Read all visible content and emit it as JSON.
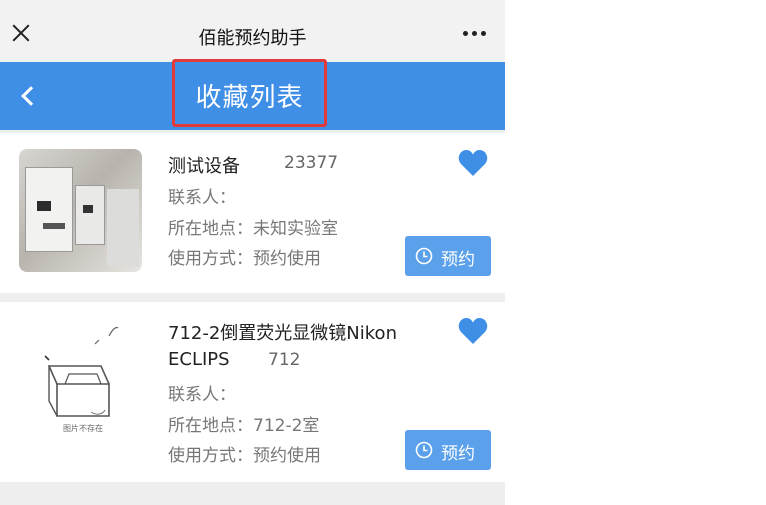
{
  "wx_bar": {
    "title": "佰能预约助手"
  },
  "header": {
    "title": "收藏列表"
  },
  "items": [
    {
      "name": "测试设备",
      "code": "23377",
      "contact": "联系人：",
      "location": "所在地点：未知实验室",
      "usage": "使用方式：预约使用",
      "reserve_label": "预约"
    },
    {
      "name_line1": "712-2倒置荧光显微镜Nikon",
      "name_line2": "ECLIPS",
      "code": "712",
      "contact": "联系人：",
      "location": "所在地点：712-2室",
      "usage": "使用方式：预约使用",
      "reserve_label": "预约",
      "image_caption": "图片不存在"
    }
  ],
  "colors": {
    "header_blue": "#3f8fe6",
    "button_blue": "#5aa0ea",
    "heart_blue": "#3f8fe6",
    "highlight_red": "#e23a3a"
  },
  "icons": [
    "close-icon",
    "more-icon",
    "back-arrow-icon",
    "heart-icon",
    "clock-icon",
    "empty-box-icon"
  ]
}
